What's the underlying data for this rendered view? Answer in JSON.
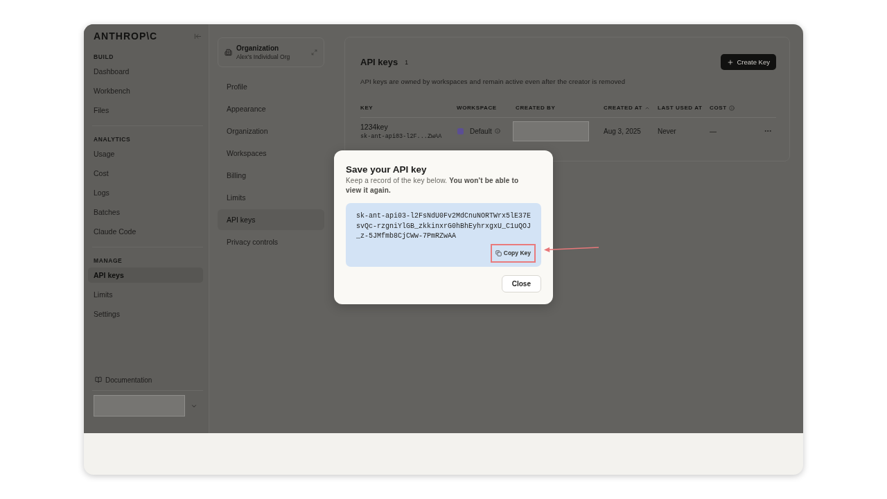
{
  "sidebar": {
    "logo": "ANTHROP\\C",
    "sections": [
      {
        "heading": "BUILD",
        "items": [
          {
            "label": "Dashboard",
            "selected": false
          },
          {
            "label": "Workbench",
            "selected": false
          },
          {
            "label": "Files",
            "selected": false
          }
        ]
      },
      {
        "heading": "ANALYTICS",
        "items": [
          {
            "label": "Usage",
            "selected": false
          },
          {
            "label": "Cost",
            "selected": false
          },
          {
            "label": "Logs",
            "selected": false
          },
          {
            "label": "Batches",
            "selected": false
          },
          {
            "label": "Claude Code",
            "selected": false
          }
        ]
      },
      {
        "heading": "MANAGE",
        "items": [
          {
            "label": "API keys",
            "selected": true
          },
          {
            "label": "Limits",
            "selected": false
          },
          {
            "label": "Settings",
            "selected": false
          }
        ]
      }
    ],
    "footer_link": "Documentation"
  },
  "settings_nav": {
    "org_card": {
      "title": "Organization",
      "subtitle": "Alex's Individual Org"
    },
    "items": [
      {
        "label": "Profile",
        "selected": false
      },
      {
        "label": "Appearance",
        "selected": false
      },
      {
        "label": "Organization",
        "selected": false
      },
      {
        "label": "Workspaces",
        "selected": false
      },
      {
        "label": "Billing",
        "selected": false
      },
      {
        "label": "Limits",
        "selected": false
      },
      {
        "label": "API keys",
        "selected": true
      },
      {
        "label": "Privacy controls",
        "selected": false
      }
    ]
  },
  "api_keys": {
    "title": "API keys",
    "count": "1",
    "create_button": "Create Key",
    "description": "API keys are owned by workspaces and remain active even after the creator is removed",
    "table": {
      "columns": [
        {
          "label": "KEY",
          "sorted": false,
          "info": false
        },
        {
          "label": "WORKSPACE",
          "sorted": false,
          "info": false
        },
        {
          "label": "CREATED BY",
          "sorted": false,
          "info": false
        },
        {
          "label": "CREATED AT",
          "sorted": true,
          "info": false
        },
        {
          "label": "LAST USED AT",
          "sorted": false,
          "info": false
        },
        {
          "label": "COST",
          "sorted": false,
          "info": true
        }
      ],
      "rows": [
        {
          "name": "1234key",
          "key": "sk-ant-api03-l2F...ZwAA",
          "workspace": {
            "name": "Default",
            "color": "#5b4e94"
          },
          "created_at": "Aug 3, 2025",
          "last_used_at": "Never",
          "cost": "—"
        }
      ]
    }
  },
  "dialog": {
    "title": "Save your API key",
    "message": "Keep a record of the key below. **You won't be able to view it again.**",
    "key": "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",
    "copy_button": {
      "label": "Copy Key",
      "highlighted": true
    },
    "close_button": "Close"
  }
}
